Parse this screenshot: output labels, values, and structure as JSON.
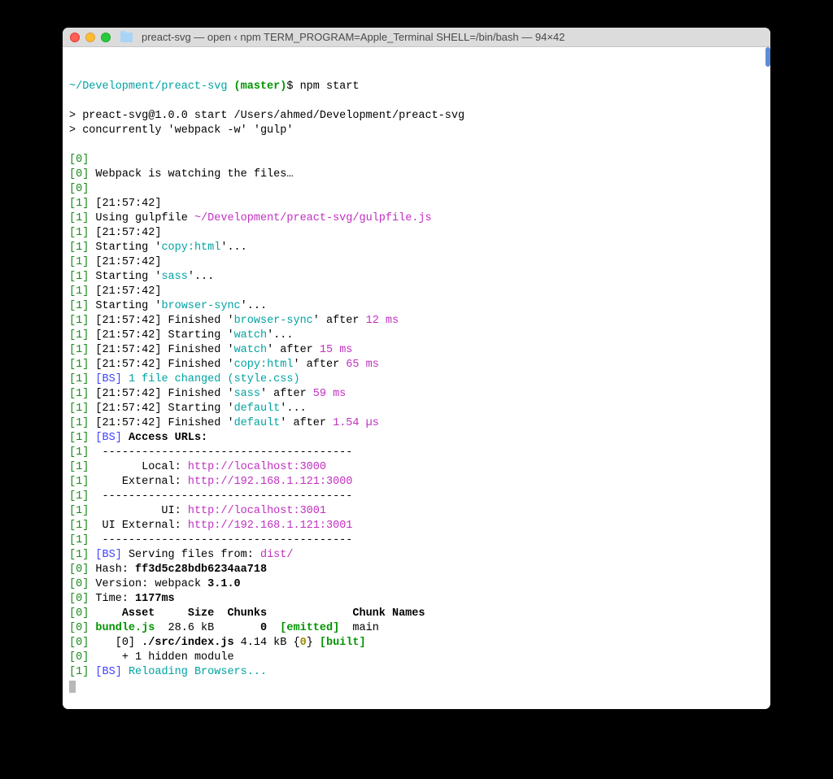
{
  "window": {
    "title": "preact-svg — open ‹ npm TERM_PROGRAM=Apple_Terminal SHELL=/bin/bash — 94×42"
  },
  "prompt": {
    "path": "~/Development/preact-svg",
    "branch": "(master)",
    "symbol": "$",
    "command": "npm start"
  },
  "run": {
    "line1": "> preact-svg@1.0.0 start /Users/ahmed/Development/preact-svg",
    "line2": "> concurrently 'webpack -w' 'gulp'"
  },
  "t": {
    "pfx0": "[0]",
    "pfx1": "[1]",
    "watching": "Webpack is watching the files…",
    "ts1": "[21:57:42]",
    "using_gulpfile": "Using gulpfile",
    "gulpfile_path": "~/Development/preact-svg/gulpfile.js",
    "starting": "Starting '",
    "finished": "Finished '",
    "after": "' after ",
    "copyhtml": "copy:html",
    "sass": "sass",
    "browsersync": "browser-sync",
    "watch": "watch",
    "default": "default",
    "d12": "12 ms",
    "d15": "15 ms",
    "d65": "65 ms",
    "d59": "59 ms",
    "d154": "1.54 µs",
    "dots": "'...",
    "bs": "[BS]",
    "one_changed": "1 file changed",
    "stylecss": "(style.css)",
    "access": "Access URLs:",
    "rule": " --------------------------------------",
    "local_l": "       Local:",
    "ext_l": "    External:",
    "ui_l": "          UI:",
    "uiext_l": " UI External:",
    "local_u": "http://localhost:3000",
    "ext_u": "http://192.168.1.121:3000",
    "ui_u": "http://localhost:3001",
    "uiext_u": "http://192.168.1.121:3001",
    "serving": "Serving files from:",
    "dist": "dist/",
    "hash_l": "Hash:",
    "hash_v": "ff3d5c28bdb6234aa718",
    "ver_l": "Version: webpack",
    "ver_v": "3.1.0",
    "time_l": "Time:",
    "time_v": "1177ms",
    "hdr": "    Asset     Size  Chunks             Chunk Names",
    "bundle": "bundle.js",
    "bsize": "28.6 kB",
    "ch0": "0",
    "emitted": "[emitted]",
    "main": "main",
    "idx0_a": "   [0]",
    "idx0_b": "./src/index.js",
    "idx0_c": "4.14 kB {",
    "idx0_d": "0",
    "idx0_e": "}",
    "built": "[built]",
    "hidden": "    + 1 hidden module",
    "reloading": "Reloading Browsers..."
  }
}
